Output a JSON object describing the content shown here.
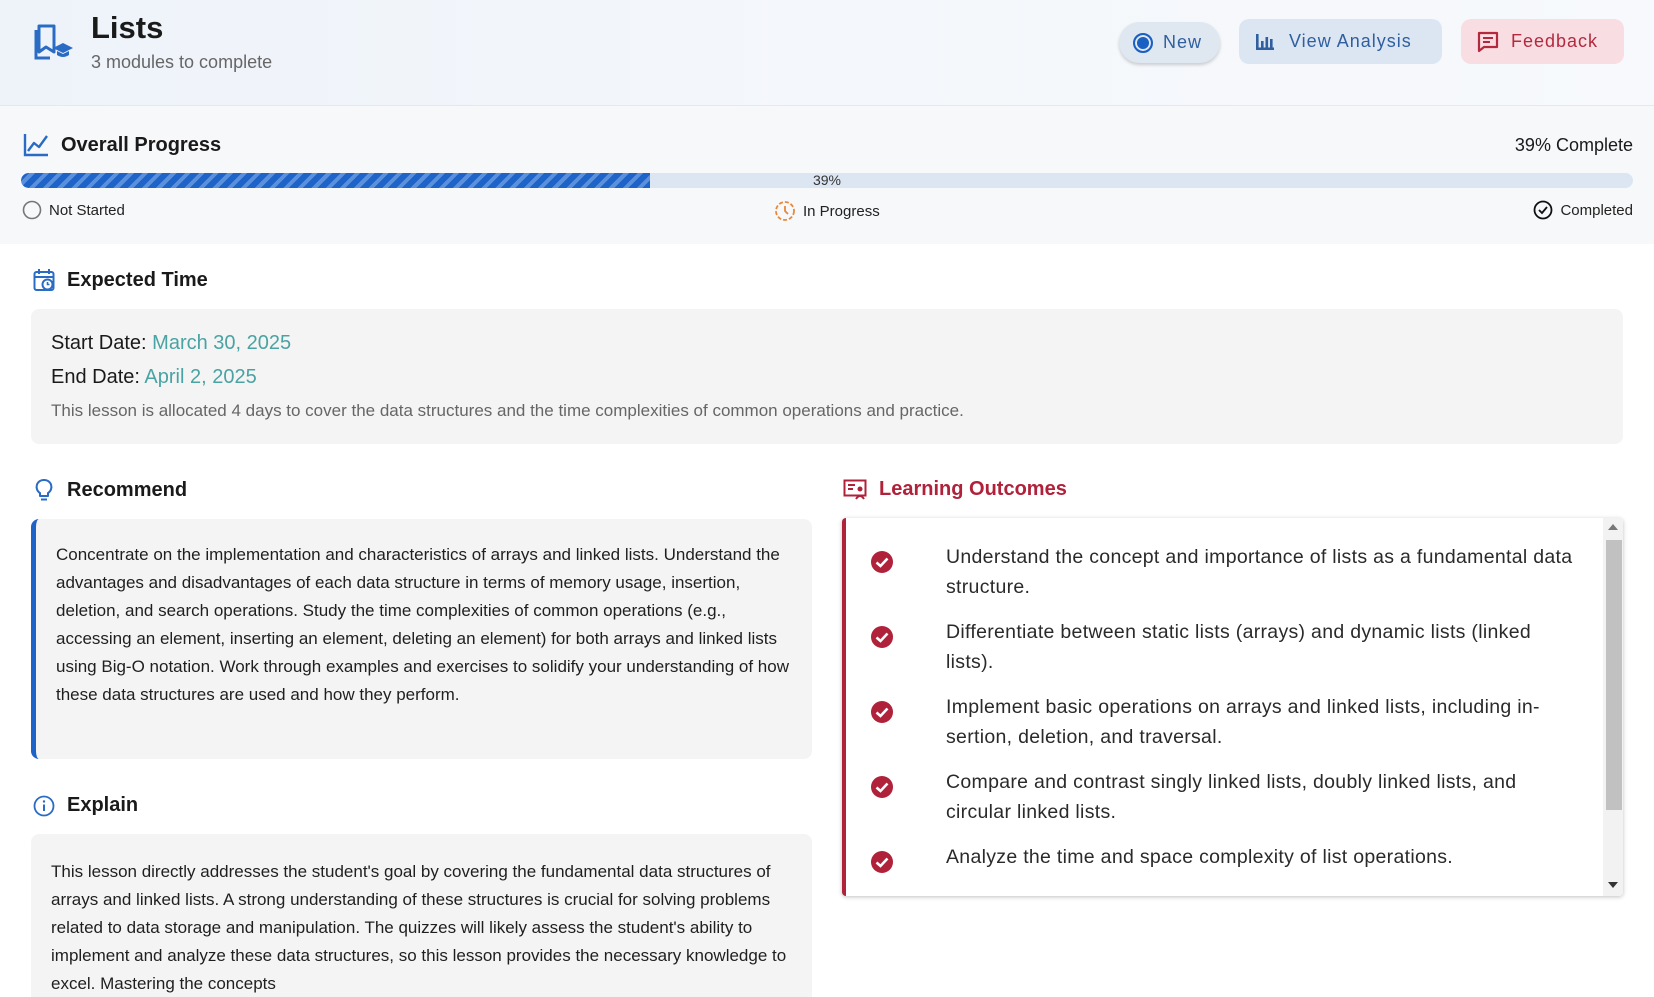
{
  "header": {
    "title": "Lists",
    "subtitle": "3 modules to complete",
    "buttons": {
      "new": "New",
      "view_analysis": "View Analysis",
      "feedback": "Feedback"
    }
  },
  "progress": {
    "title": "Overall Progress",
    "percent_text": "39% Complete",
    "percent_value": 39,
    "bar_label": "39%",
    "legend": {
      "not_started": "Not Started",
      "in_progress": "In Progress",
      "completed": "Completed"
    }
  },
  "expected_time": {
    "title": "Expected Time",
    "start_label": "Start Date:",
    "start_value": "March 30, 2025",
    "end_label": "End Date:",
    "end_value": "April 2, 2025",
    "description": "This lesson is allocated 4 days to cover the data structures and the time complexities of common operations and practice."
  },
  "recommend": {
    "title": "Recommend",
    "text": "Concentrate on the implementation and characteristics of arrays and linked lists. Understand the advantages and disadvantages of each data structure in terms of memory usage, insertion, deletion, and search operations. Study the time complexities of common operations (e.g., accessing an element, inserting an element, deleting an element) for both arrays and linked lists using Big-O notation. Work through examples and exercises to solidify your understanding of how these data structures are used and how they perform."
  },
  "explain": {
    "title": "Explain",
    "text": "This lesson directly addresses the student's goal by covering the fundamental data structures of arrays and linked lists. A strong understanding of these structures is crucial for solving problems related to data storage and manipulation. The quizzes will likely assess the student's ability to implement and analyze these data structures, so this lesson provides the necessary knowledge to excel. Mastering the concepts"
  },
  "outcomes": {
    "title": "Learning Outcomes",
    "items": [
      "Understand the concept and importance of lists as a fundamental data structure.",
      "Differentiate between static lists (arrays) and dynamic lists (linked lists).",
      "Implement basic operations on arrays and linked lists, including in-sertion, deletion, and traversal.",
      "Compare and contrast singly linked lists, doubly linked lists, and circular linked lists.",
      "Analyze the time and space complexity of list operations."
    ]
  },
  "colors": {
    "primary": "#1e63c7",
    "accent_teal": "#4aa3a3",
    "danger": "#b0213a",
    "in_progress": "#e8883a"
  }
}
